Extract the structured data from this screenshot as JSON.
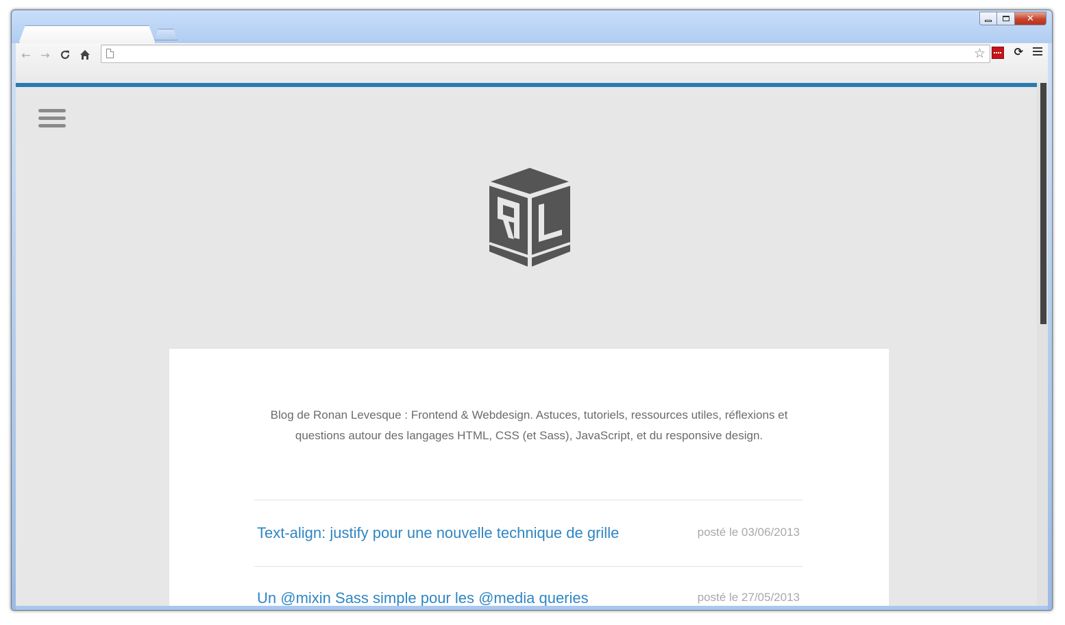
{
  "browser": {
    "tab_title": "",
    "address_value": "",
    "address_placeholder": "",
    "icons": {
      "back": "back-arrow-icon",
      "forward": "forward-arrow-icon",
      "reload": "reload-icon",
      "home": "home-icon",
      "bookmark": "star-icon",
      "menu": "menu-icon"
    },
    "window_controls": {
      "minimize": "",
      "maximize": "",
      "close": "✕"
    }
  },
  "page": {
    "accent_color": "#2a7ab0",
    "background_color": "#e7e7e7",
    "tagline": "Blog de Ronan Levesque : Frontend & Webdesign. Astuces, tutoriels, ressources utiles, réflexions et questions autour des langages HTML, CSS (et Sass), JavaScript, et du responsive design.",
    "posts": [
      {
        "title": "Text-align: justify pour une nouvelle technique de grille",
        "date": "posté le 03/06/2013"
      },
      {
        "title": "Un @mixin Sass simple pour les @media queries",
        "date": "posté le 27/05/2013"
      }
    ]
  }
}
